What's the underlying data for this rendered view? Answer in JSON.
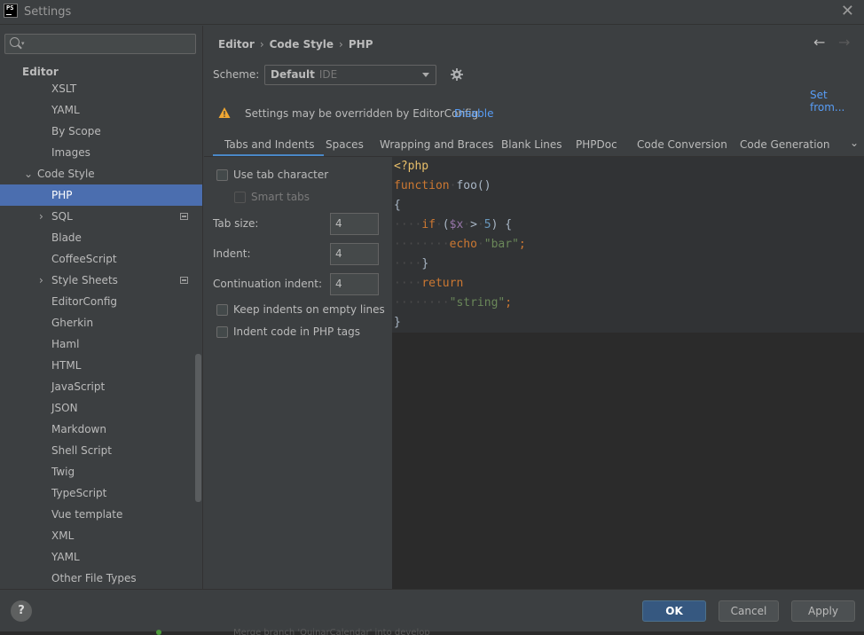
{
  "window": {
    "title": "Settings",
    "app_icon_text": "PS"
  },
  "search": {
    "placeholder": ""
  },
  "sidebar": {
    "section": "Editor",
    "items": [
      {
        "label": "XSLT"
      },
      {
        "label": "YAML"
      },
      {
        "label": "By Scope"
      },
      {
        "label": "Images"
      },
      {
        "label": "Code Style",
        "expanded": true
      },
      {
        "label": "PHP",
        "selected": true
      },
      {
        "label": "SQL",
        "expandable": true,
        "modified_icon": true
      },
      {
        "label": "Blade"
      },
      {
        "label": "CoffeeScript"
      },
      {
        "label": "Style Sheets",
        "expandable": true,
        "modified_icon": true
      },
      {
        "label": "EditorConfig"
      },
      {
        "label": "Gherkin"
      },
      {
        "label": "Haml"
      },
      {
        "label": "HTML"
      },
      {
        "label": "JavaScript"
      },
      {
        "label": "JSON"
      },
      {
        "label": "Markdown"
      },
      {
        "label": "Shell Script"
      },
      {
        "label": "Twig"
      },
      {
        "label": "TypeScript"
      },
      {
        "label": "Vue template"
      },
      {
        "label": "XML"
      },
      {
        "label": "YAML"
      },
      {
        "label": "Other File Types"
      }
    ]
  },
  "breadcrumb": {
    "items": [
      "Editor",
      "Code Style",
      "PHP"
    ],
    "separator": "›"
  },
  "scheme": {
    "label": "Scheme:",
    "value": "Default",
    "kind": "IDE"
  },
  "set_from": "Set from...",
  "warning": {
    "text": "Settings may be overridden by EditorConfig",
    "link": "Disable"
  },
  "tabs": {
    "items": [
      "Tabs and Indents",
      "Spaces",
      "Wrapping and Braces",
      "Blank Lines",
      "PHPDoc",
      "Code Conversion",
      "Code Generation"
    ],
    "active": "Tabs and Indents"
  },
  "options": {
    "use_tab": {
      "label": "Use tab character",
      "checked": false
    },
    "smart_tabs": {
      "label": "Smart tabs",
      "checked": false,
      "enabled": false
    },
    "tab_size": {
      "label": "Tab size:",
      "value": "4"
    },
    "indent": {
      "label": "Indent:",
      "value": "4"
    },
    "continuation": {
      "label": "Continuation indent:",
      "value": "4"
    },
    "keep_indents": {
      "label": "Keep indents on empty lines",
      "checked": false
    },
    "indent_php_tags": {
      "label": "Indent code in PHP tags",
      "checked": false
    }
  },
  "code": {
    "l1": "<?php",
    "l2_kw": "function",
    "l2_rest": "foo()",
    "l3": "{",
    "l4_kw": "if",
    "l4_open": "(",
    "l4_var": "$x",
    "l4_op": ">",
    "l4_num": "5",
    "l4_close": ") {",
    "l5_kw": "echo",
    "l5_str": "\"bar\"",
    "l5_end": ";",
    "l6": "}",
    "l7_kw": "return",
    "l8_str": "\"string\"",
    "l8_end": ";",
    "l9": "}"
  },
  "footer": {
    "help": "?",
    "ok": "OK",
    "cancel": "Cancel",
    "apply": "Apply"
  },
  "background_hint": "Merge branch 'QuinarCalendar' into develop"
}
